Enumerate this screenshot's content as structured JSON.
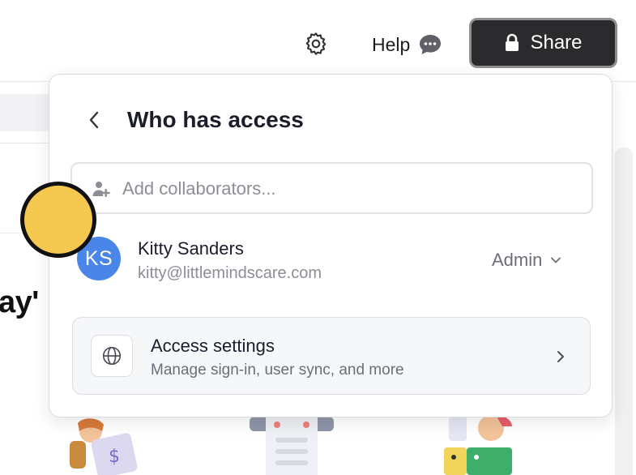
{
  "header": {
    "settings_icon": "gear-icon",
    "help_label": "Help",
    "help_icon": "chat-bubble-icon",
    "share_label": "Share",
    "share_icon": "lock-icon",
    "share_bg": "#2b2b2d"
  },
  "background": {
    "heading_fragment": "ay'"
  },
  "popover": {
    "title": "Who has access",
    "back_icon": "chevron-left-icon",
    "add_input": {
      "placeholder": "Add collaborators...",
      "value": "",
      "icon": "add-person-icon"
    },
    "members": [
      {
        "initials": "KS",
        "name": "Kitty Sanders",
        "email": "kitty@littlemindscare.com",
        "role": "Admin",
        "avatar_color": "#4a86e8"
      }
    ],
    "access_settings": {
      "title": "Access settings",
      "subtitle": "Manage sign-in, user sync, and more",
      "icon": "globe-icon",
      "chevron_icon": "chevron-right-icon"
    }
  },
  "cursor": {
    "color": "#f5c94f"
  }
}
